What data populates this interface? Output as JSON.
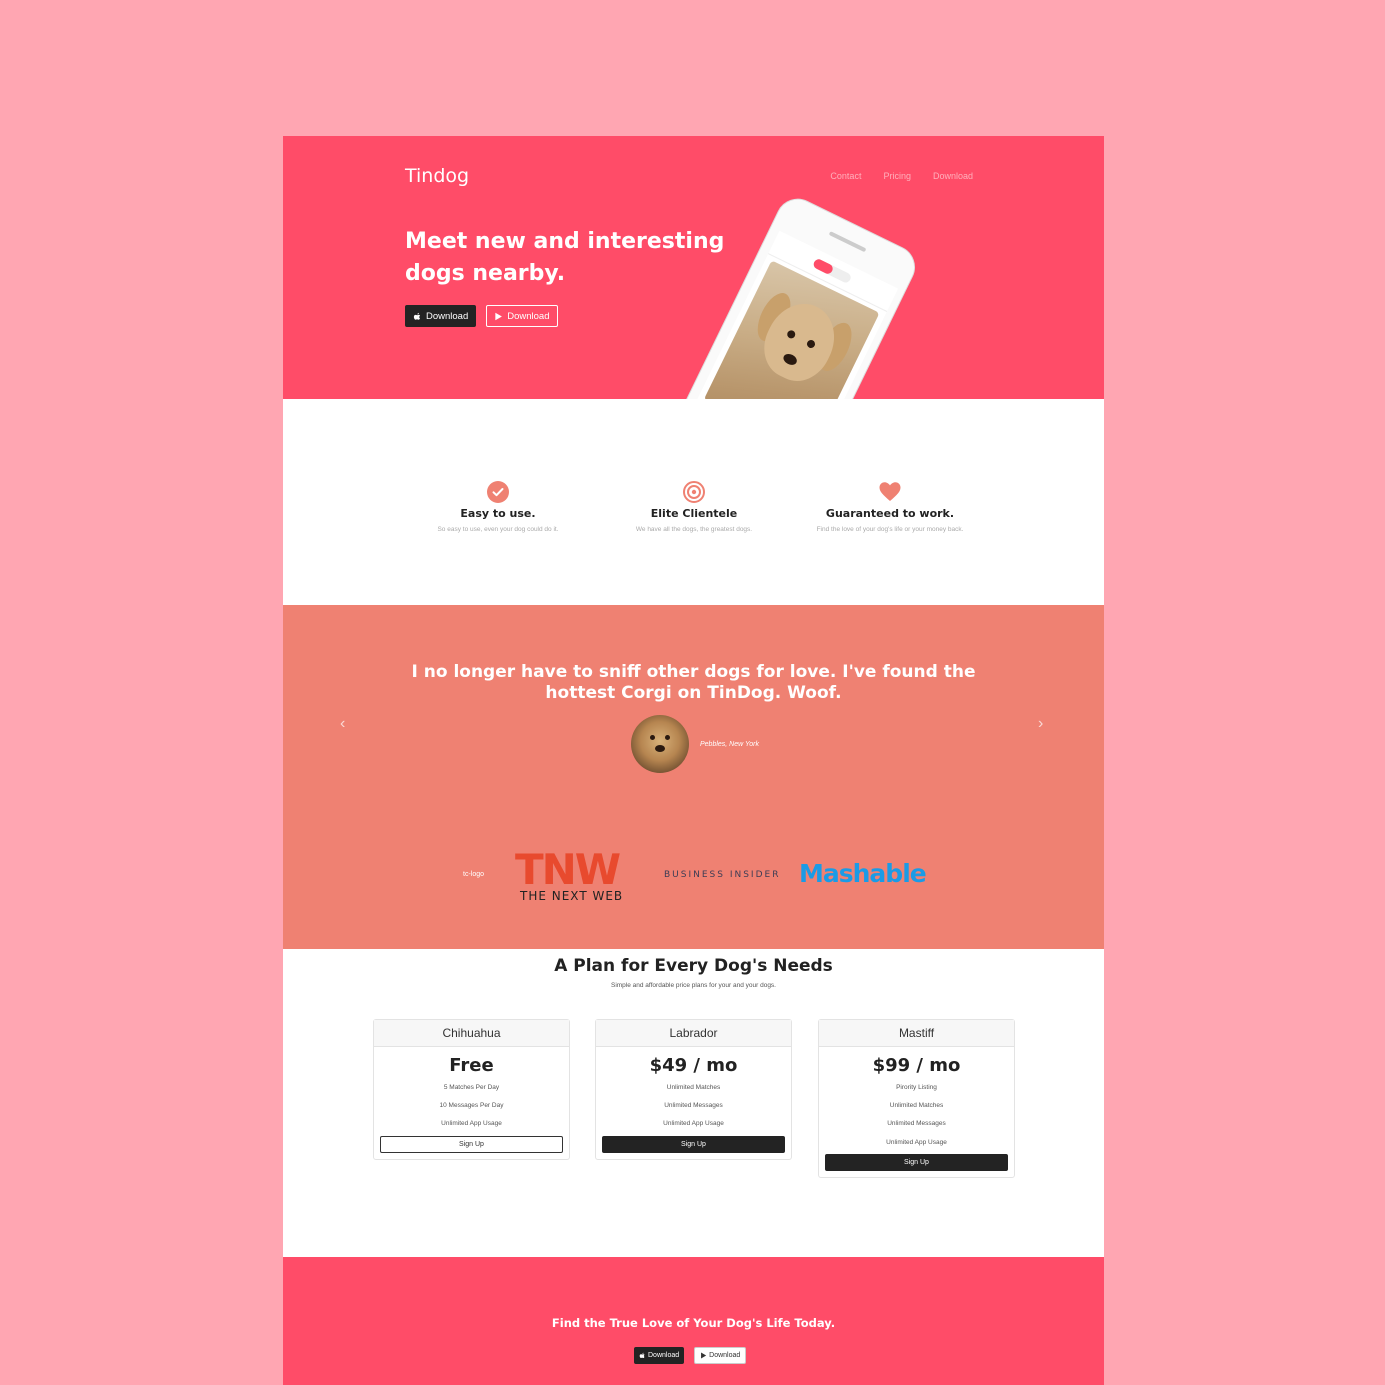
{
  "nav": {
    "brand": "Tindog",
    "links": [
      "Contact",
      "Pricing",
      "Download"
    ]
  },
  "hero": {
    "title": "Meet new and interesting dogs nearby.",
    "apple_download": "Download",
    "google_download": "Download"
  },
  "features": [
    {
      "icon": "check-circle-icon",
      "title": "Easy to use.",
      "text": "So easy to use, even your dog could do it."
    },
    {
      "icon": "bullseye-icon",
      "title": "Elite Clientele",
      "text": "We have all the dogs, the greatest dogs."
    },
    {
      "icon": "heart-icon",
      "title": "Guaranteed to work.",
      "text": "Find the love of your dog's life or your money back."
    }
  ],
  "testimonial": {
    "quote": "I no longer have to sniff other dogs for love. I've found the hottest Corgi on TinDog. Woof.",
    "author": "Pebbles, New York"
  },
  "press": {
    "broken_image_alt": "tc-logo",
    "tnw_mark": "TNW",
    "tnw_text": "THE NEXT WEB",
    "business_insider": "BUSINESS INSIDER",
    "mashable": "Mashable"
  },
  "pricing": {
    "title": "A Plan for Every Dog's Needs",
    "subtitle": "Simple and affordable price plans for your and your dogs.",
    "plans": [
      {
        "name": "Chihuahua",
        "price": "Free",
        "features": [
          "5 Matches Per Day",
          "10 Messages Per Day",
          "Unlimited App Usage"
        ],
        "button": "Sign Up",
        "style": "outline"
      },
      {
        "name": "Labrador",
        "price": "$49 / mo",
        "features": [
          "Unlimited Matches",
          "Unlimited Messages",
          "Unlimited App Usage"
        ],
        "button": "Sign Up",
        "style": "dark"
      },
      {
        "name": "Mastiff",
        "price": "$99 / mo",
        "features": [
          "Pirority Listing",
          "Unlimited Matches",
          "Unlimited Messages",
          "Unlimited App Usage"
        ],
        "button": "Sign Up",
        "style": "dark"
      }
    ]
  },
  "cta": {
    "title": "Find the True Love of Your Dog's Life Today.",
    "apple_download": "Download",
    "google_download": "Download"
  },
  "colors": {
    "background": "#ffa6b2",
    "brand": "#ff4c68",
    "accent": "#ef8172",
    "dark": "#232323"
  }
}
